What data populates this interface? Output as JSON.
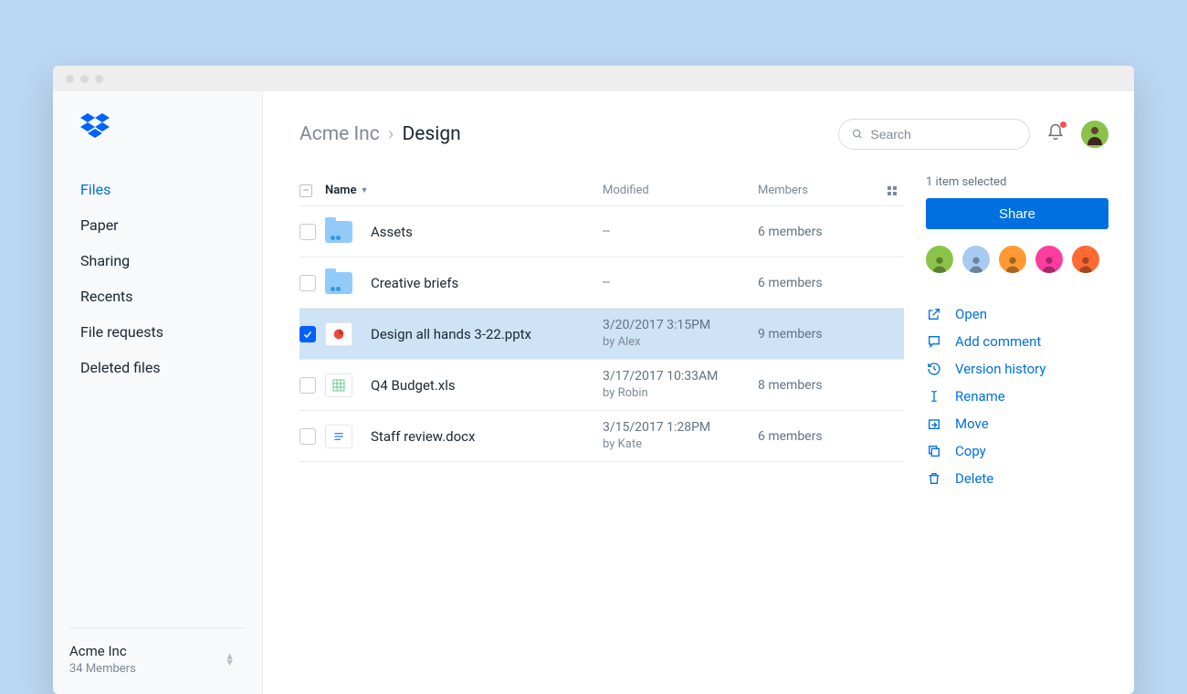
{
  "sidebar": {
    "nav": [
      {
        "label": "Files",
        "active": true
      },
      {
        "label": "Paper"
      },
      {
        "label": "Sharing"
      },
      {
        "label": "Recents"
      },
      {
        "label": "File requests"
      },
      {
        "label": "Deleted files"
      }
    ],
    "team": {
      "name": "Acme Inc",
      "members": "34 Members"
    }
  },
  "header": {
    "breadcrumb": {
      "parent": "Acme Inc",
      "sep": "›",
      "current": "Design"
    },
    "search_placeholder": "Search"
  },
  "table": {
    "headers": {
      "name": "Name",
      "modified": "Modified",
      "members": "Members"
    },
    "rows": [
      {
        "type": "folder",
        "name": "Assets",
        "modified": "--",
        "by": "",
        "members": "6 members",
        "selected": false
      },
      {
        "type": "folder",
        "name": "Creative briefs",
        "modified": "--",
        "by": "",
        "members": "6 members",
        "selected": false
      },
      {
        "type": "pptx",
        "name": "Design all hands 3-22.pptx",
        "modified": "3/20/2017 3:15PM",
        "by": "by Alex",
        "members": "9 members",
        "selected": true
      },
      {
        "type": "xls",
        "name": "Q4 Budget.xls",
        "modified": "3/17/2017 10:33AM",
        "by": "by Robin",
        "members": "8 members",
        "selected": false
      },
      {
        "type": "docx",
        "name": "Staff review.docx",
        "modified": "3/15/2017 1:28PM",
        "by": "by Kate",
        "members": "6 members",
        "selected": false
      }
    ]
  },
  "rail": {
    "selected_text": "1 item selected",
    "share_label": "Share",
    "member_colors": [
      "#8bc34a",
      "#a7caf0",
      "#ff9933",
      "#ff3d9e",
      "#ff6a33"
    ],
    "actions": [
      {
        "label": "Open",
        "icon": "open"
      },
      {
        "label": "Add comment",
        "icon": "comment"
      },
      {
        "label": "Version history",
        "icon": "history"
      },
      {
        "label": "Rename",
        "icon": "rename"
      },
      {
        "label": "Move",
        "icon": "move"
      },
      {
        "label": "Copy",
        "icon": "copy"
      },
      {
        "label": "Delete",
        "icon": "delete"
      }
    ]
  }
}
